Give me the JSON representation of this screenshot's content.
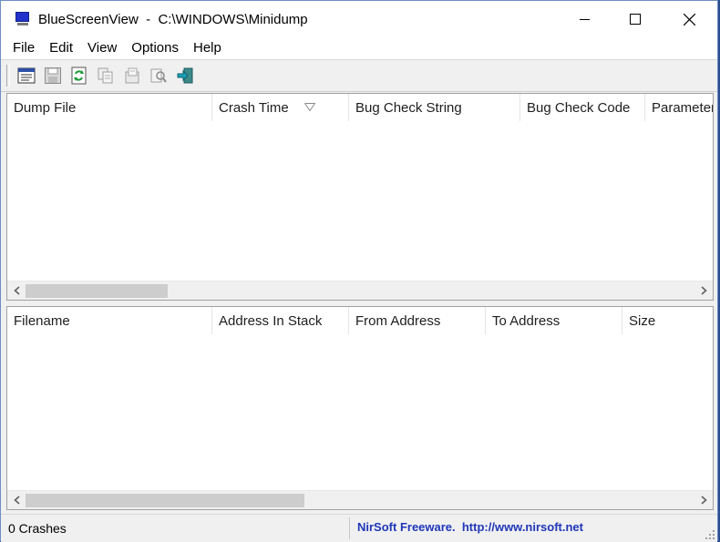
{
  "window": {
    "title": "BlueScreenView  -  C:\\WINDOWS\\Minidump"
  },
  "menu": [
    "File",
    "Edit",
    "View",
    "Options",
    "Help"
  ],
  "toolbar": {
    "buttons": [
      "properties-icon",
      "save-icon",
      "refresh-icon",
      "copy-icon",
      "html-report-icon",
      "find-icon",
      "exit-icon"
    ]
  },
  "crash_list": {
    "columns": [
      "Dump File",
      "Crash Time",
      "Bug Check String",
      "Bug Check Code",
      "Parameter"
    ],
    "sorted_column": "Crash Time",
    "rows": []
  },
  "driver_list": {
    "columns": [
      "Filename",
      "Address In Stack",
      "From Address",
      "To Address",
      "Size"
    ],
    "rows": []
  },
  "status": {
    "count": "0 Crashes",
    "link": "NirSoft Freeware.  http://www.nirsoft.net"
  },
  "colors": {
    "link": "#1f36b8",
    "desktop": "#2a4d8f",
    "window_bg": "#f0f0f0"
  }
}
